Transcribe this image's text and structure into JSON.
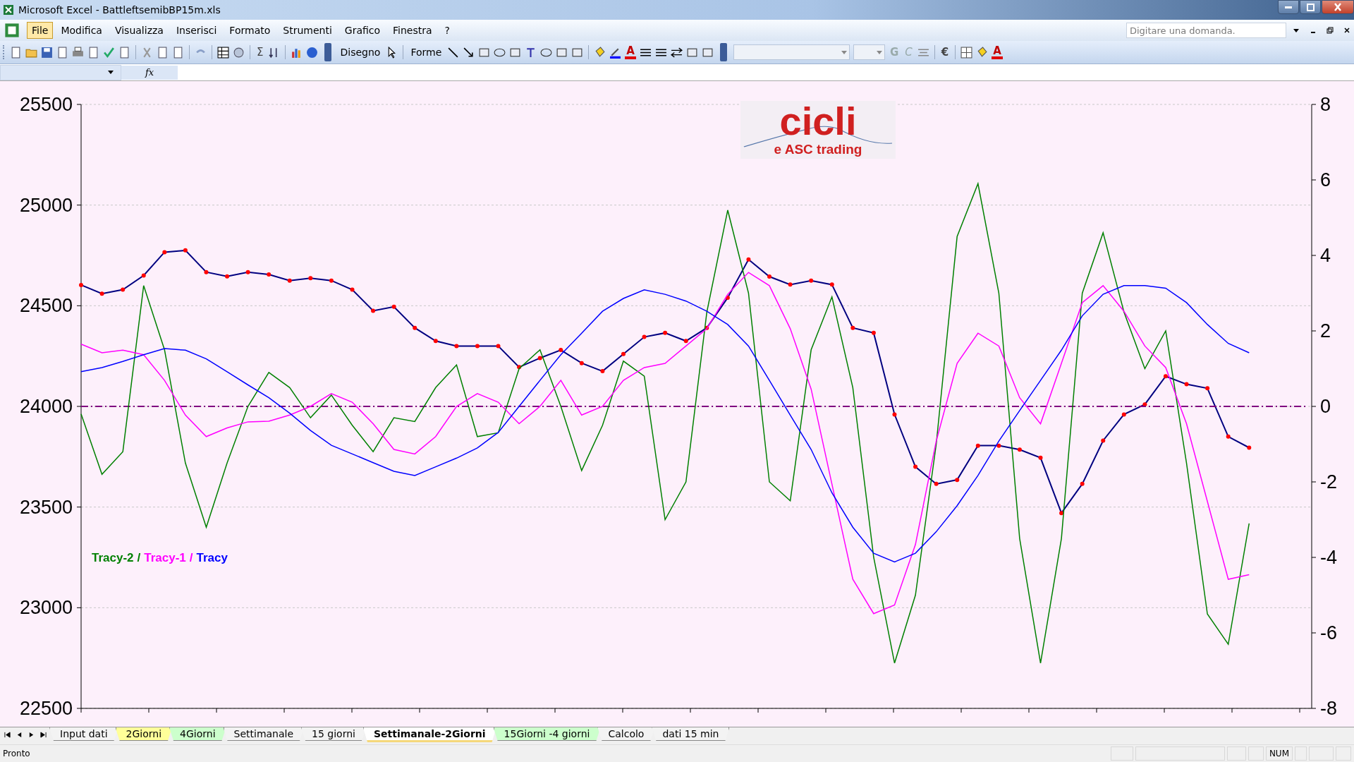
{
  "window": {
    "title": "Microsoft Excel - BattleftsemibBP15m.xls"
  },
  "menu": [
    {
      "label": "File",
      "selected": true
    },
    {
      "label": "Modifica",
      "selected": false
    },
    {
      "label": "Visualizza",
      "selected": false
    },
    {
      "label": "Inserisci",
      "selected": false
    },
    {
      "label": "Formato",
      "selected": false
    },
    {
      "label": "Strumenti",
      "selected": false
    },
    {
      "label": "Grafico",
      "selected": false
    },
    {
      "label": "Finestra",
      "selected": false
    },
    {
      "label": "?",
      "selected": false
    }
  ],
  "help_search": {
    "placeholder": "Digitare una domanda."
  },
  "toolbar": {
    "sum": "Σ",
    "drawing": "Disegno",
    "shapes": "Forme",
    "bold": "G",
    "italic": "C",
    "currency": "€",
    "font_color": "A",
    "fill_color": "A"
  },
  "formula_bar": {
    "function": "fx"
  },
  "chart": {
    "logo": {
      "title": "cicli",
      "subtitle": "e ASC trading"
    },
    "legend_separator": "/",
    "price_chart": {
      "chart_data": {
        "type": "line",
        "categories": [
          null,
          null,
          null,
          null,
          null,
          null,
          null,
          null,
          null,
          null,
          null,
          null,
          null,
          null,
          null,
          null,
          null,
          null,
          null,
          null,
          null,
          null,
          null,
          null,
          null,
          null,
          null,
          null,
          null,
          null,
          null,
          null,
          null,
          null,
          null,
          null,
          null,
          null,
          null,
          null,
          null,
          null,
          null,
          null,
          null,
          null,
          null,
          null,
          null,
          null,
          null,
          null,
          null,
          null,
          null,
          null,
          null,
          null,
          null,
          null
        ],
        "ylim": [
          22500,
          25500
        ],
        "yticks": [
          22500,
          23000,
          23500,
          24000,
          24500,
          25000,
          25500
        ],
        "grid": true,
        "series": [
          {
            "color": "#000080",
            "marker": true,
            "values": [
              24603,
              24560,
              24580,
              24650,
              24766,
              24775,
              24667,
              24646,
              24667,
              24655,
              24625,
              24637,
              24625,
              24580,
              24475,
              24495,
              24390,
              24325,
              24300,
              24300,
              24300,
              24195,
              24240,
              24280,
              24215,
              24175,
              24260,
              24345,
              24365,
              24325,
              24390,
              24540,
              24730,
              24645,
              24605,
              24625,
              24605,
              24390,
              24365,
              23960,
              23700,
              23615,
              23635,
              23805,
              23805,
              23785,
              23745,
              23470,
              23615,
              23830,
              23960,
              24010,
              24150,
              24110,
              24090,
              23850,
              23795,
              null,
              null,
              null
            ]
          }
        ]
      }
    },
    "tracy_chart": {
      "zero_line": true,
      "chart_data": {
        "type": "line",
        "categories": [
          null,
          null,
          null,
          null,
          null,
          null,
          null,
          null,
          null,
          null,
          null,
          null,
          null,
          null,
          null,
          null,
          null,
          null,
          null,
          null,
          null,
          null,
          null,
          null,
          null,
          null,
          null,
          null,
          null,
          null,
          null,
          null,
          null,
          null,
          null,
          null,
          null,
          null,
          null,
          null,
          null,
          null,
          null,
          null,
          null,
          null,
          null,
          null,
          null,
          null,
          null,
          null,
          null,
          null,
          null,
          null,
          null,
          null,
          null,
          null
        ],
        "ylim": [
          -8,
          8
        ],
        "yticks": [
          -8,
          -6,
          -4,
          -2,
          0,
          2,
          4,
          6,
          8
        ],
        "series": [
          {
            "name": "Tracy-2",
            "color": "#008000",
            "values": [
              -0.2,
              -1.8,
              -1.2,
              3.2,
              1.5,
              -1.5,
              -3.2,
              -1.5,
              0,
              0.9,
              0.5,
              -0.3,
              0.3,
              -0.5,
              -1.2,
              -0.3,
              -0.4,
              0.5,
              1.1,
              -0.8,
              -0.7,
              1.0,
              1.5,
              0,
              -1.7,
              -0.5,
              1.2,
              0.8,
              -3.0,
              -2.0,
              2.5,
              5.2,
              3.0,
              -2.0,
              -2.5,
              1.5,
              2.9,
              0.5,
              -4.0,
              -6.8,
              -5.0,
              -1.0,
              4.5,
              5.9,
              3.0,
              -3.5,
              -6.8,
              -3.5,
              3.0,
              4.6,
              2.5,
              1.0,
              2.0,
              -1.5,
              -5.5,
              -6.3,
              -3.1,
              null,
              null,
              null
            ]
          },
          {
            "name": "Tracy-1",
            "color": "#ff00ff",
            "values": [
              1.65,
              1.42,
              1.49,
              1.37,
              0.69,
              -0.23,
              -0.8,
              -0.57,
              -0.41,
              -0.39,
              -0.23,
              0,
              0.34,
              0.11,
              -0.46,
              -1.14,
              -1.26,
              -0.8,
              0,
              0.34,
              0.11,
              -0.46,
              0,
              0.69,
              -0.23,
              0,
              0.69,
              1.03,
              1.14,
              1.6,
              2.06,
              2.97,
              3.55,
              3.2,
              2.06,
              0.46,
              -2.06,
              -4.58,
              -5.49,
              -5.26,
              -3.66,
              -0.92,
              1.14,
              1.94,
              1.6,
              0.23,
              -0.46,
              1.14,
              2.75,
              3.2,
              2.52,
              1.6,
              1.03,
              -0.46,
              -2.52,
              -4.58,
              -4.46,
              null,
              null,
              null
            ]
          },
          {
            "name": "Tracy",
            "color": "#0000ff",
            "values": [
              0.92,
              1.03,
              1.19,
              1.37,
              1.53,
              1.49,
              1.26,
              0.92,
              0.57,
              0.23,
              -0.18,
              -0.64,
              -1.03,
              -1.26,
              -1.49,
              -1.72,
              -1.83,
              -1.6,
              -1.37,
              -1.1,
              -0.69,
              0,
              0.69,
              1.37,
              1.94,
              2.52,
              2.86,
              3.09,
              2.97,
              2.79,
              2.52,
              2.17,
              1.6,
              0.69,
              -0.23,
              -1.14,
              -2.29,
              -3.2,
              -3.89,
              -4.12,
              -3.89,
              -3.32,
              -2.63,
              -1.83,
              -0.92,
              -0.11,
              0.69,
              1.49,
              2.4,
              2.97,
              3.2,
              3.2,
              3.13,
              2.75,
              2.17,
              1.67,
              1.42,
              null,
              null,
              null
            ]
          }
        ]
      }
    }
  },
  "sheet_tabs": [
    {
      "label": "Input dati",
      "selected": false
    },
    {
      "label": "2Giorni",
      "selected": false,
      "color": "#ffff99"
    },
    {
      "label": "4Giorni",
      "selected": false,
      "color": "#ccffcc"
    },
    {
      "label": "Settimanale",
      "selected": false
    },
    {
      "label": "15 giorni",
      "selected": false
    },
    {
      "label": "Settimanale-2Giorni",
      "selected": true
    },
    {
      "label": "15Giorni -4 giorni",
      "selected": false,
      "color": "#ccffcc"
    },
    {
      "label": "Calcolo",
      "selected": false
    },
    {
      "label": "dati 15 min",
      "selected": false
    }
  ],
  "status_bar": {
    "message": "Pronto",
    "num_lock": "NUM"
  }
}
